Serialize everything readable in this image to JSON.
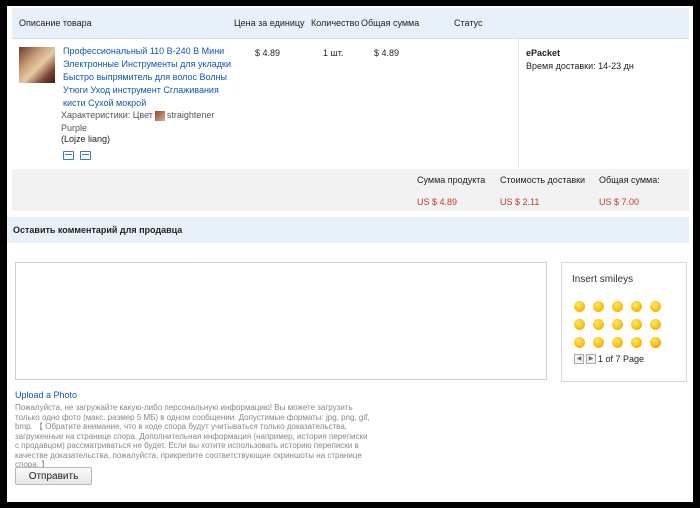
{
  "table": {
    "headers": {
      "description": "Описание товара",
      "unit_price": "Цена за единицу",
      "quantity": "Количество",
      "total": "Общая сумма",
      "status": "Статус"
    }
  },
  "product": {
    "title": "Профессиональный 110 В-240 В Мини Электронные Инструменты для укладки Быстро выпрямитель для волос Волны Утюги Уход инструмент Сглаживания кисти Сухой мокрой",
    "chars_label": "Характеристики: Цвет",
    "chars_value": "straightener Purple",
    "brand": "(Lojze liang)",
    "unit_price": "$ 4.89",
    "quantity": "1 шт.",
    "total": "$ 4.89",
    "shipping_method": "ePacket",
    "delivery_time": "Время доставки: 14-23 дн",
    "icons": [
      "image-icon",
      "card-icon"
    ]
  },
  "summary": {
    "product_sum_label": "Сумма продукта",
    "product_sum_value": "US $ 4.89",
    "shipping_label": "Стоимость доставки",
    "shipping_value": "US $ 2.11",
    "grand_total_label": "Общая сумма:",
    "grand_total_value": "US $ 7.00"
  },
  "comment": {
    "header": "Оставить комментарий для продавца",
    "textarea_value": ""
  },
  "smileys": {
    "title": "Insert smileys",
    "page_text": "1 of 7 Page",
    "prev_label": "◀",
    "next_label": "▶"
  },
  "upload": {
    "link": "Upload a Photo",
    "note": "Пожалуйста, не загружайте какую-либо персональную информацию! Вы можете загрузить только одно фото (макс. размер 5 МБ) в одном сообщении. Допустимые форматы: jpg, png, gif, bmp. 【 Обратите внимание, что в ходе спора будут учитываться только доказательства, загруженные на странице спора. Дополнительная информация (например, история переписки с продавцом) рассматриваться не будет. Если вы хотите использовать историю переписки в качестве доказательства, пожалуйста, прикрепите соответствующие скриншоты на странице спора. 】"
  },
  "actions": {
    "send": "Отправить"
  },
  "colors": {
    "header_bg": "#e8f1fa",
    "link": "#1155bb",
    "price_red": "#c0392b"
  }
}
